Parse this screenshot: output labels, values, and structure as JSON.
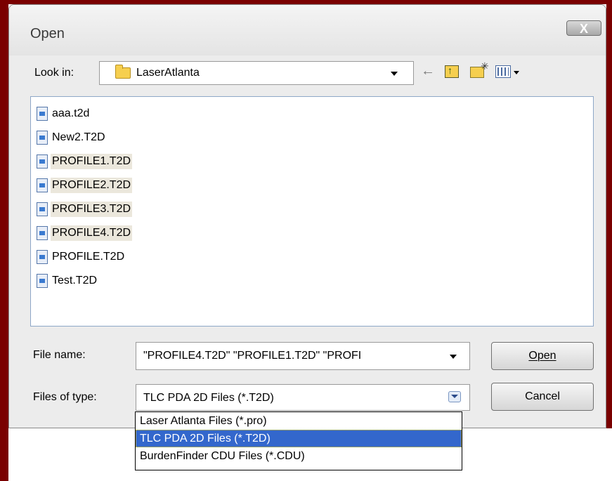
{
  "dialog": {
    "title": "Open",
    "close_label": "X"
  },
  "lookin": {
    "label": "Look in:",
    "value": "LaserAtlanta"
  },
  "toolbar": {
    "back_icon": "back-arrow-icon",
    "up_icon": "up-folder-icon",
    "new_folder_icon": "new-folder-icon",
    "view_menu_icon": "view-menu-icon"
  },
  "files": [
    {
      "name": "aaa.t2d",
      "selected": false
    },
    {
      "name": "New2.T2D",
      "selected": false
    },
    {
      "name": "PROFILE1.T2D",
      "selected": true
    },
    {
      "name": "PROFILE2.T2D",
      "selected": true
    },
    {
      "name": "PROFILE3.T2D",
      "selected": true
    },
    {
      "name": "PROFILE4.T2D",
      "selected": true
    },
    {
      "name": "PROFILE.T2D",
      "selected": false
    },
    {
      "name": "Test.T2D",
      "selected": false
    }
  ],
  "filename": {
    "label": "File name:",
    "value": "\"PROFILE4.T2D\" \"PROFILE1.T2D\" \"PROFI"
  },
  "filetype": {
    "label": "Files of type:",
    "value": "TLC PDA 2D Files (*.T2D)",
    "options": [
      {
        "label": "Laser Atlanta Files (*.pro)",
        "selected": false
      },
      {
        "label": "TLC PDA 2D Files (*.T2D)",
        "selected": true
      },
      {
        "label": "BurdenFinder CDU Files (*.CDU)",
        "selected": false
      }
    ]
  },
  "buttons": {
    "open": "Open",
    "cancel": "Cancel"
  },
  "colors": {
    "background_frame": "#7a0000",
    "selection": "#3367cc",
    "selected_file_bg": "#ebe7dc"
  }
}
